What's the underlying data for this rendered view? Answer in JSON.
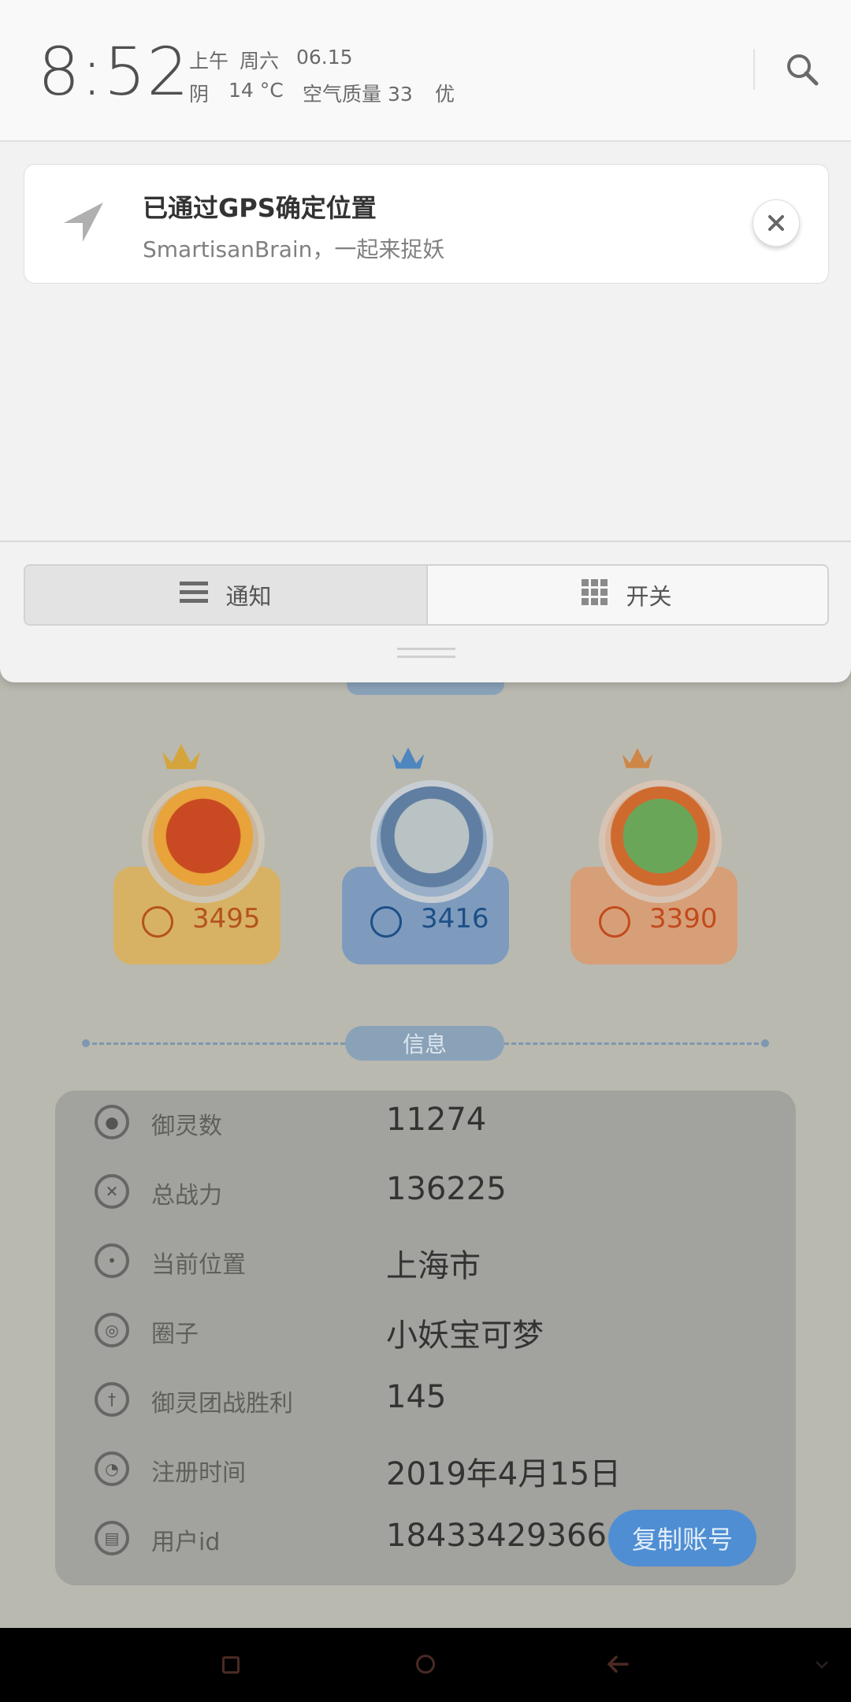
{
  "status": {
    "time": "8:52",
    "period": "上午",
    "weekday": "周六",
    "date": "06.15",
    "weather": "阴",
    "temperature": "14 °C",
    "air_quality_label": "空气质量 33",
    "air_quality_level": "优"
  },
  "notification": {
    "title": "已通过GPS确定位置",
    "body": "SmartisanBrain，一起来捉妖"
  },
  "shade_tabs": {
    "notifications": "通知",
    "toggles": "开关"
  },
  "app": {
    "section_info_label": "信息",
    "champions": [
      {
        "score": "3495",
        "color": "#d8b264"
      },
      {
        "score": "3416",
        "color": "#7e9bbd"
      },
      {
        "score": "3390",
        "color": "#d79f78"
      }
    ],
    "info_rows": [
      {
        "label": "御灵数",
        "value": "11274",
        "icon": "spirit-icon"
      },
      {
        "label": "总战力",
        "value": "136225",
        "icon": "power-icon"
      },
      {
        "label": "当前位置",
        "value": "上海市",
        "icon": "location-icon"
      },
      {
        "label": "圈子",
        "value": "小妖宝可梦",
        "icon": "circle-icon"
      },
      {
        "label": "御灵团战胜利",
        "value": "145",
        "icon": "team-battle-icon"
      },
      {
        "label": "注册时间",
        "value": "2019年4月15日",
        "icon": "clock-icon"
      },
      {
        "label": "用户id",
        "value": "18433429366",
        "icon": "id-icon"
      }
    ],
    "copy_button": "复制账号"
  }
}
